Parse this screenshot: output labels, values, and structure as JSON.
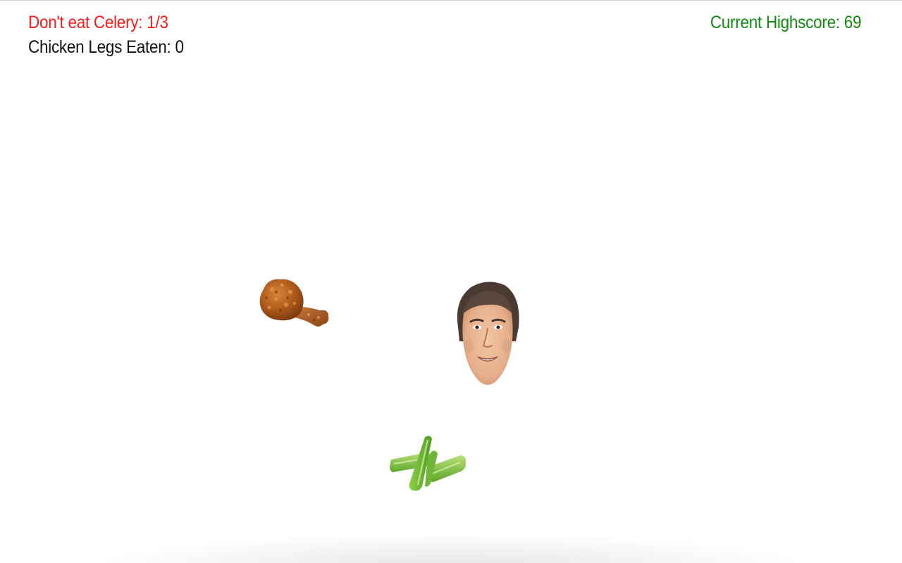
{
  "hud": {
    "celery_warning": "Don't eat Celery: 1/3",
    "chicken_legs_eaten": "Chicken Legs Eaten: 0",
    "highscore": "Current Highscore: 69"
  },
  "sprites": {
    "chicken": "chicken-leg-icon",
    "player": "face-icon",
    "celery": "celery-icon"
  },
  "colors": {
    "warning": "#ff1a1a",
    "counter": "#111111",
    "highscore": "#118a11"
  }
}
